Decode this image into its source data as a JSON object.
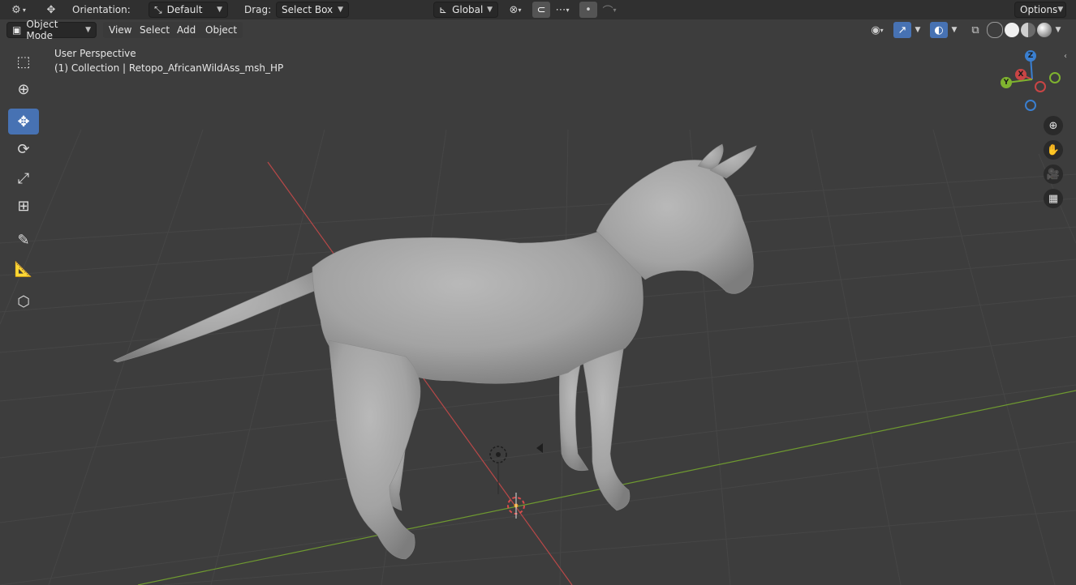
{
  "toolbar": {
    "transform_pivot_icon": "transform-icon",
    "orientation_label": "Orientation:",
    "orientation_value": "Default",
    "drag_label": "Drag:",
    "drag_value": "Select Box",
    "transform_orientation_value": "Global",
    "options_label": "Options"
  },
  "header": {
    "mode_value": "Object Mode",
    "menus": [
      "View",
      "Select",
      "Add",
      "Object"
    ]
  },
  "viewport_info": {
    "perspective": "User Perspective",
    "collection_line": "(1) Collection | Retopo_AfricanWildAss_msh_HP"
  },
  "gizmo": {
    "z": "Z",
    "x": "X",
    "y": "Y"
  },
  "colors": {
    "x_axis": "#c94545",
    "y_axis": "#7fb32f",
    "z_axis": "#3a7fd0",
    "accent": "#4772b3"
  },
  "tools": [
    "select-box-icon",
    "cursor-icon",
    "move-icon",
    "rotate-icon",
    "scale-icon",
    "transform-icon",
    "annotate-icon",
    "measure-icon",
    "add-cube-icon"
  ]
}
